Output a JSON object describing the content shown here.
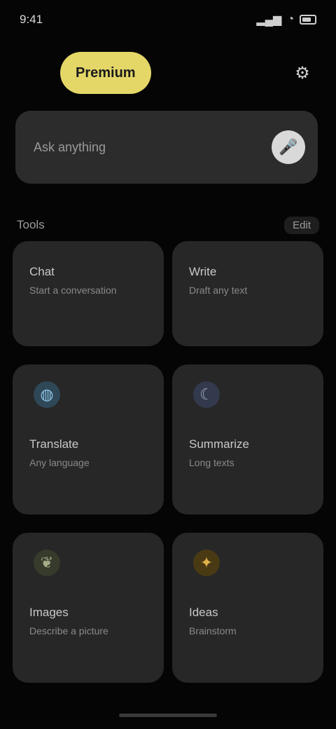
{
  "status_bar": {
    "time": "9:41",
    "signal_icon": "signal-icon",
    "wifi_icon": "wifi-icon",
    "battery_icon": "battery-icon"
  },
  "header": {
    "premium_label": "Premium",
    "settings_icon": "gear-icon"
  },
  "search": {
    "placeholder": "Ask anything",
    "mic_icon": "mic-icon"
  },
  "section": {
    "title": "Tools",
    "edit_label": "Edit"
  },
  "tiles": [
    {
      "title": "Chat",
      "subtitle": "Start a conversation",
      "icon": "",
      "color": ""
    },
    {
      "title": "Write",
      "subtitle": "Draft any text",
      "icon": "",
      "color": ""
    },
    {
      "title": "Translate",
      "subtitle": "Any language",
      "icon": "globe-icon",
      "color": "#6fa6c9"
    },
    {
      "title": "Summarize",
      "subtitle": "Long texts",
      "icon": "moon-icon",
      "color": "#7b86a8"
    },
    {
      "title": "Images",
      "subtitle": "Describe a picture",
      "icon": "leaf-icon",
      "color": "#7f8a6a"
    },
    {
      "title": "Ideas",
      "subtitle": "Brainstorm",
      "icon": "bulb-icon",
      "color": "#c99a2e"
    }
  ],
  "colors": {
    "accent": "#e4d768",
    "background": "#050505",
    "card": "#272727"
  }
}
